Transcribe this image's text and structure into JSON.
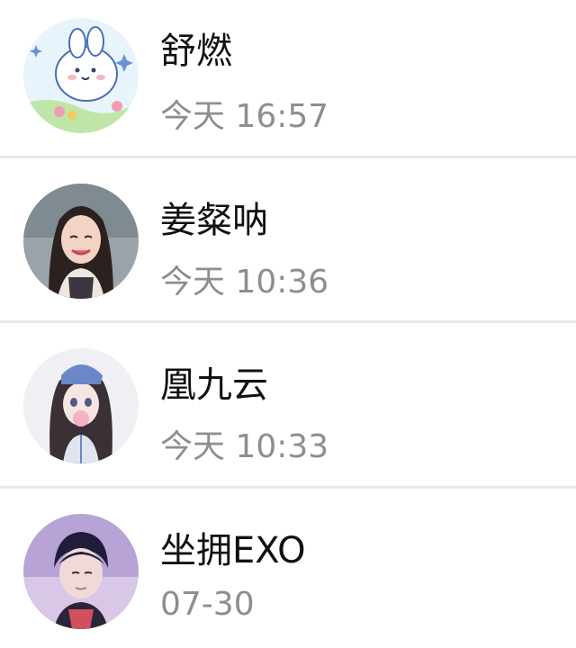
{
  "conversations": [
    {
      "name": "舒燃",
      "time": "今天 16:57",
      "avatar_icon": "cartoon-bunny-avatar"
    },
    {
      "name": "姜粲呐",
      "time": "今天 10:36",
      "avatar_icon": "girl-portrait-avatar"
    },
    {
      "name": "凰九云",
      "time": "今天 10:33",
      "avatar_icon": "anime-girl-avatar"
    },
    {
      "name": "坐拥EXO",
      "time": "07-30",
      "avatar_icon": "boy-portrait-avatar"
    }
  ],
  "colors": {
    "background": "#ffffff",
    "name_text": "#111111",
    "time_text": "#8e8e8e",
    "divider": "#e9e9e9"
  }
}
